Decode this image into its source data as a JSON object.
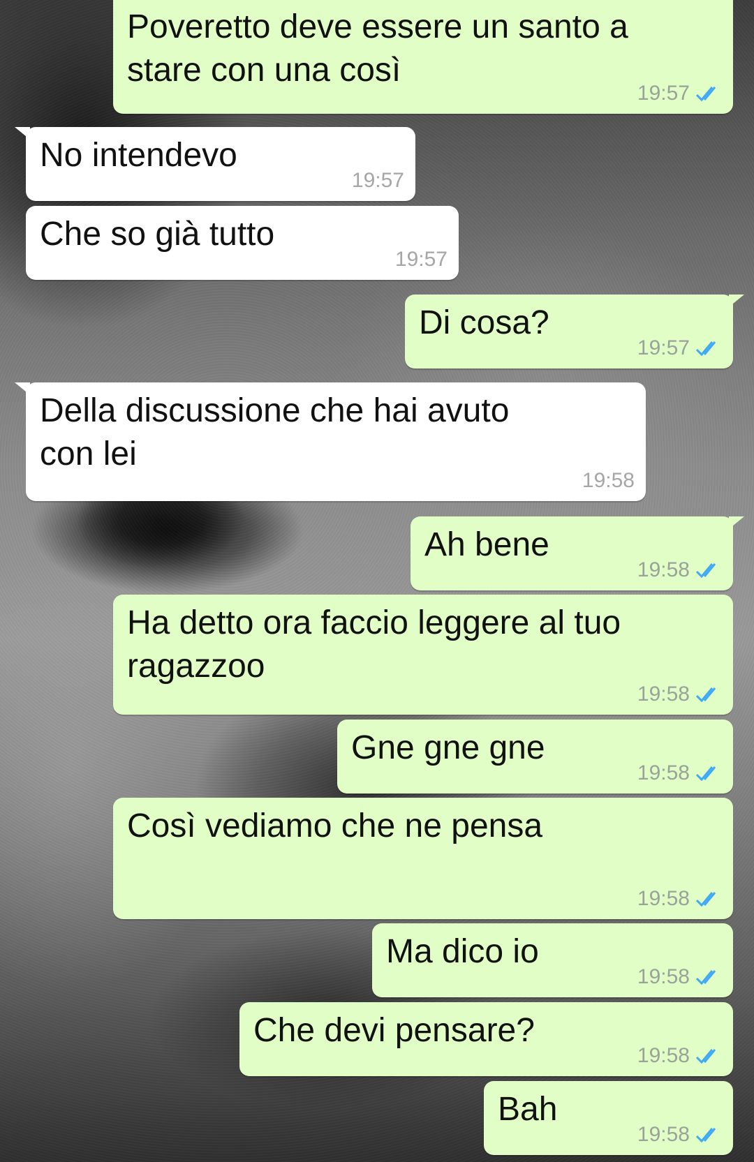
{
  "messages": [
    {
      "direction": "out",
      "text": "Poveretto deve essere un santo a\nstare con una così",
      "time": "19:57",
      "ticks": "double-check-icon"
    },
    {
      "direction": "in",
      "text": "No intendevo",
      "time": "19:57"
    },
    {
      "direction": "in",
      "text": "Che so già tutto",
      "time": "19:57"
    },
    {
      "direction": "out",
      "text": "Di cosa?",
      "time": "19:57",
      "ticks": "double-check-icon"
    },
    {
      "direction": "in",
      "text": "Della discussione che hai avuto\ncon lei",
      "time": "19:58"
    },
    {
      "direction": "out",
      "text": "Ah bene",
      "time": "19:58",
      "ticks": "double-check-icon"
    },
    {
      "direction": "out",
      "text": "Ha detto ora faccio leggere al tuo\nragazzoo",
      "time": "19:58",
      "ticks": "double-check-icon"
    },
    {
      "direction": "out",
      "text": "Gne gne gne",
      "time": "19:58",
      "ticks": "double-check-icon"
    },
    {
      "direction": "out",
      "text": "Così vediamo che ne pensa",
      "time": "19:58",
      "ticks": "double-check-icon"
    },
    {
      "direction": "out",
      "text": "Ma dico io",
      "time": "19:58",
      "ticks": "double-check-icon"
    },
    {
      "direction": "out",
      "text": "Che devi pensare?",
      "time": "19:58",
      "ticks": "double-check-icon"
    },
    {
      "direction": "out",
      "text": "Bah",
      "time": "19:58",
      "ticks": "double-check-icon"
    }
  ],
  "colors": {
    "outgoing_bubble": "#e1fec6",
    "incoming_bubble": "#ffffff",
    "read_ticks": "#3fa9f5",
    "timestamp": "#9aa39a"
  }
}
